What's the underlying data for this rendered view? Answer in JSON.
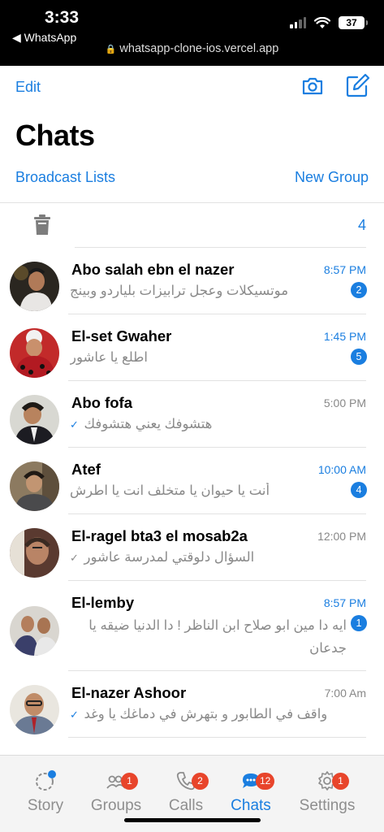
{
  "status": {
    "time": "3:33",
    "back_label": "◀ WhatsApp",
    "battery": "37",
    "url": "whatsapp-clone-ios.vercel.app"
  },
  "header": {
    "edit_label": "Edit",
    "title": "Chats",
    "broadcast_label": "Broadcast Lists",
    "new_group_label": "New Group",
    "archived_count": "4"
  },
  "chats": [
    {
      "name": "Abo salah ebn el nazer",
      "time": "8:57 PM",
      "message": "موتسيكلات وعجل ترابيزات بلياردو وبينج",
      "unread": "2",
      "check": ""
    },
    {
      "name": "El-set Gwaher",
      "time": "1:45 PM",
      "message": "اطلع يا عاشور",
      "unread": "5",
      "check": ""
    },
    {
      "name": "Abo fofa",
      "time": "5:00 PM",
      "message": "هتشوفك يعني هتشوفك",
      "unread": "",
      "check": "✓"
    },
    {
      "name": "Atef",
      "time": "10:00 AM",
      "message": "أنت يا حيوان يا متخلف انت يا اطرش",
      "unread": "4",
      "check": ""
    },
    {
      "name": "El-ragel bta3 el mosab2a",
      "time": "12:00 PM",
      "message": "السؤال دلوقتي لمدرسة عاشور",
      "unread": "",
      "check": "✓"
    },
    {
      "name": "El-lemby",
      "time": "8:57 PM",
      "message": "ايه دا مين ابو صلاح ابن الناظر ! دا الدنيا ضيقه يا جدعان",
      "unread": "1",
      "check": ""
    },
    {
      "name": "El-nazer Ashoor",
      "time": "7:00 Am",
      "message": "واقف في الطابور و بتهرش في دماغك يا وغد",
      "unread": "",
      "check": "✓"
    }
  ],
  "tabs": [
    {
      "label": "Story",
      "badge": ""
    },
    {
      "label": "Groups",
      "badge": "1"
    },
    {
      "label": "Calls",
      "badge": "2"
    },
    {
      "label": "Chats",
      "badge": "12"
    },
    {
      "label": "Settings",
      "badge": "1"
    }
  ],
  "colors": {
    "accent": "#1a7ee0",
    "badge_red": "#e8452b",
    "secondary_text": "#8a8a8a"
  }
}
